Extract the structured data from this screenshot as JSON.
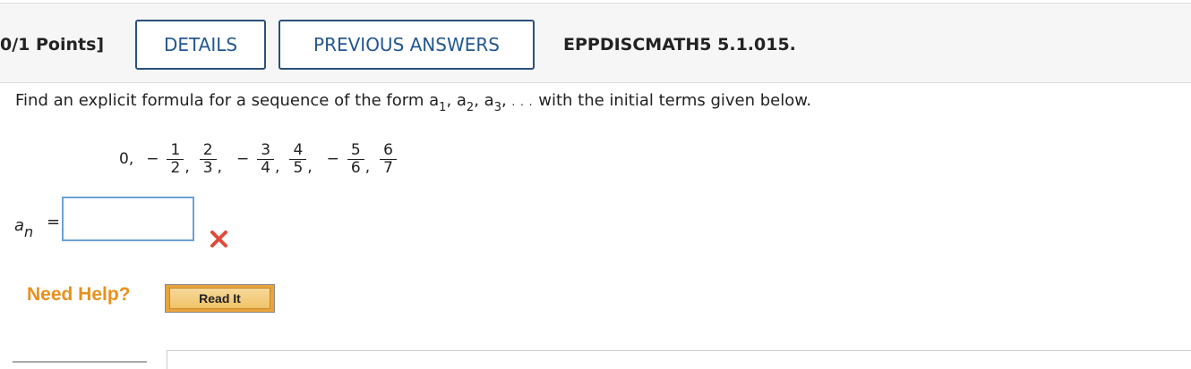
{
  "header": {
    "points_label": "0/1 Points]",
    "details_label": "DETAILS",
    "previous_answers_label": "PREVIOUS ANSWERS",
    "problem_code": "EPPDISCMATH5 5.1.015."
  },
  "question": {
    "prompt_before": "Find an explicit formula for a sequence of the form ",
    "prompt_seq": [
      "a",
      "1",
      "a",
      "2",
      "a",
      "3"
    ],
    "prompt_ellipsis": ". . .",
    "prompt_after": " with the initial terms given below.",
    "first_term": "0,",
    "terms": [
      {
        "sign": "−",
        "num": "1",
        "den": "2"
      },
      {
        "sign": "",
        "num": "2",
        "den": "3"
      },
      {
        "sign": "−",
        "num": "3",
        "den": "4"
      },
      {
        "sign": "",
        "num": "4",
        "den": "5"
      },
      {
        "sign": "−",
        "num": "5",
        "den": "6"
      },
      {
        "sign": "",
        "num": "6",
        "den": "7"
      }
    ]
  },
  "answer": {
    "label_var": "a",
    "label_sub": "n",
    "equals": "=",
    "value": "",
    "status_icon": "incorrect-x-icon",
    "status_color": "#e04a3a"
  },
  "help": {
    "need_help_label": "Need Help?",
    "read_it_label": "Read It"
  }
}
